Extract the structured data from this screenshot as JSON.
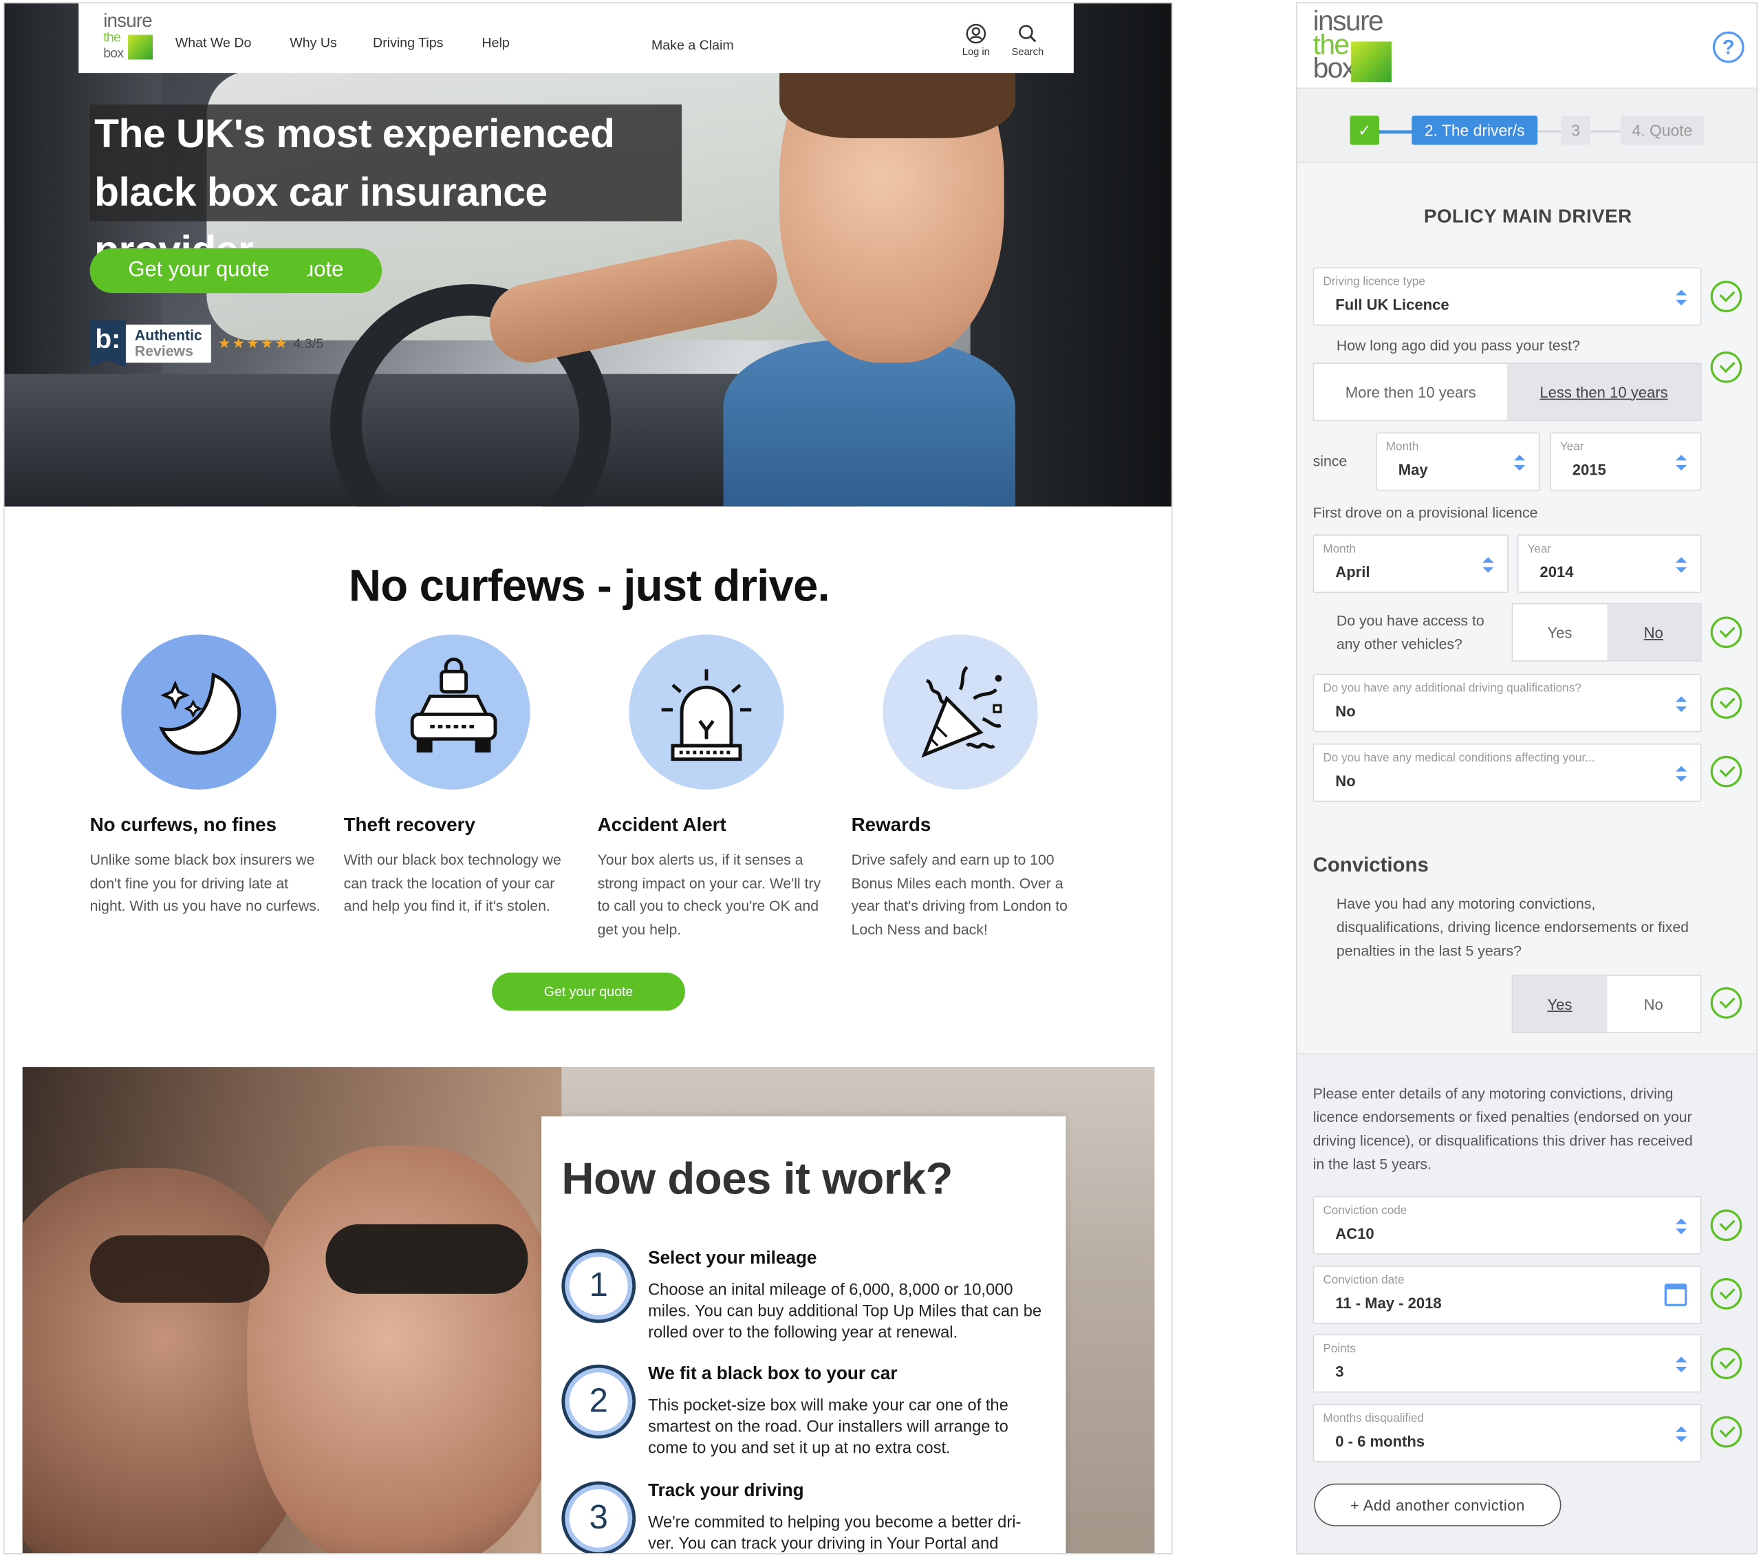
{
  "site": {
    "logo": {
      "line1": "insure",
      "line2": "the",
      "line3": "box"
    },
    "nav": {
      "items": [
        "What We Do",
        "Why Us",
        "Driving Tips",
        "Help"
      ],
      "make_claim": "Make a Claim",
      "quote_button": "Get your quote",
      "login_label": "Log in",
      "search_label": "Search"
    },
    "hero": {
      "headline_line1": "The UK's most experienced",
      "headline_line2": "black box car insurance provider",
      "cta": "Get your quote",
      "reviews": {
        "badge": "b:",
        "line1": "Authentic",
        "line2": "Reviews",
        "stars": "★★★★★",
        "score": "4.3/5"
      }
    },
    "features": {
      "title": "No curfews - just drive.",
      "items": [
        {
          "title": "No curfews, no fines",
          "text": "Unlike some black box insurers we don't fine you for driving late at night. With us you have no curfews.",
          "icon": "moon-stars-icon"
        },
        {
          "title": "Theft recovery",
          "text": "With our black box technology we can track the location of your car and help you find it, if it's stolen.",
          "icon": "car-lock-icon"
        },
        {
          "title": "Accident Alert",
          "text": "Your box alerts us, if it senses a strong impact on your car. We'll try to call you to check you're OK and get you help.",
          "icon": "siren-icon"
        },
        {
          "title": "Rewards",
          "text": "Drive safely and earn up to 100 Bonus Miles each month. Over a year that's driving from London to Loch Ness and back!",
          "icon": "party-popper-icon"
        }
      ],
      "cta": "Get your quote"
    },
    "how": {
      "title": "How does it work?",
      "steps": [
        {
          "num": "1",
          "title": "Select your mileage",
          "text": "Choose an inital mileage of 6,000, 8,000 or 10,000 miles. You can buy additional Top Up Miles that can be rolled over to the following year at renewal."
        },
        {
          "num": "2",
          "title": "We fit a black box to your car",
          "text": "This pocket-size box will make your car one of the smartest on the road. Our installers will arrange to come to you and set it up at no extra cost."
        },
        {
          "num": "3",
          "title": "Track your driving",
          "text": "We're commited to helping you become a better dri-ver. You can track your driving in Your Portal and"
        }
      ]
    }
  },
  "form": {
    "logo": {
      "line1": "insure",
      "line2": "the",
      "line3": "box"
    },
    "help": "?",
    "progress": {
      "step1": "✓",
      "step2": "2. The driver/s",
      "step3": "3",
      "step4": "4. Quote"
    },
    "section_title": "POLICY MAIN DRIVER",
    "licence_type": {
      "label": "Driving licence type",
      "value": "Full UK Licence"
    },
    "passed_test": {
      "question": "How long ago did you pass your test?",
      "option1": "More then 10 years",
      "option2": "Less then 10 years",
      "selected": "Less then 10 years"
    },
    "since": {
      "label": "since",
      "month_label": "Month",
      "month": "May",
      "year_label": "Year",
      "year": "2015"
    },
    "provisional": {
      "label": "First drove on a provisional licence",
      "month_label": "Month",
      "month": "April",
      "year_label": "Year",
      "year": "2014"
    },
    "other_vehicles": {
      "question": "Do you have access to any other vehicles?",
      "yes": "Yes",
      "no": "No",
      "selected": "No"
    },
    "qualifications": {
      "label": "Do you have any additional driving qualifications?",
      "value": "No"
    },
    "medical": {
      "label": "Do you have any medical conditions affecting your...",
      "value": "No"
    },
    "convictions": {
      "title": "Convictions",
      "question": "Have you had any motoring convictions, disqualifications, driving licence endorsements or fixed penalties in the last 5 years?",
      "yes": "Yes",
      "no": "No",
      "selected": "Yes",
      "details_text": "Please enter details of any motoring convictions, driving licence endorsements or fixed penalties (endorsed on your driving licence), or disqualifications this driver has received in the last 5 years.",
      "code": {
        "label": "Conviction code",
        "value": "AC10"
      },
      "date": {
        "label": "Conviction date",
        "value": "11 - May - 2018"
      },
      "points": {
        "label": "Points",
        "value": "3"
      },
      "disqualified": {
        "label": "Months disqualified",
        "value": "0 - 6 months"
      },
      "add_button": "+ Add another conviction"
    }
  },
  "colors": {
    "green": "#5dc126",
    "blue": "#3d8de0",
    "navy": "#1f3c5d",
    "icon_circle": "#9ec0f1"
  }
}
